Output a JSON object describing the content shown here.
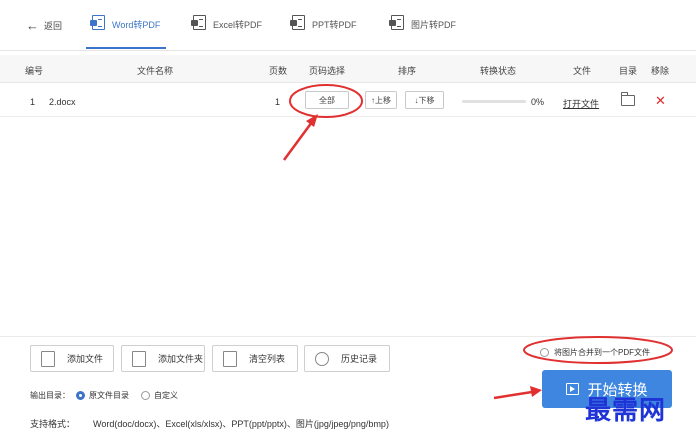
{
  "header": {
    "back_label": "返回",
    "tabs": [
      {
        "label": "Word转PDF",
        "active": true
      },
      {
        "label": "Excel转PDF",
        "active": false
      },
      {
        "label": "PPT转PDF",
        "active": false
      },
      {
        "label": "图片转PDF",
        "active": false
      }
    ]
  },
  "table": {
    "columns": [
      "编号",
      "文件名称",
      "页数",
      "页码选择",
      "排序",
      "转换状态",
      "文件",
      "目录",
      "移除"
    ],
    "rows": [
      {
        "index": "1",
        "filename": "2.docx",
        "pages": "1",
        "page_select": "全部",
        "move_up": "↑上移",
        "move_down": "↓下移",
        "progress": 0,
        "progress_text": "0%",
        "open_file": "打开文件",
        "remove": "✕"
      }
    ]
  },
  "actions": {
    "add_file": "添加文件",
    "add_folder": "添加文件夹",
    "clear_list": "清空列表",
    "history": "历史记录"
  },
  "merge_option": "将图片合并到一个PDF文件",
  "output": {
    "label": "输出目录：",
    "options": [
      {
        "label": "原文件目录",
        "selected": true
      },
      {
        "label": "自定义",
        "selected": false
      }
    ]
  },
  "formats": {
    "label": "支持格式：",
    "value": "Word(doc/docx)、Excel(xls/xlsx)、PPT(ppt/pptx)、图片(jpg/jpeg/png/bmp)"
  },
  "start_button": "开始转换",
  "watermark": "最需网",
  "colors": {
    "accent": "#3b74c9",
    "start_button": "#3f86e0",
    "annotation": "#e03030",
    "remove": "#e02b2b",
    "watermark": "#1f33d6"
  }
}
